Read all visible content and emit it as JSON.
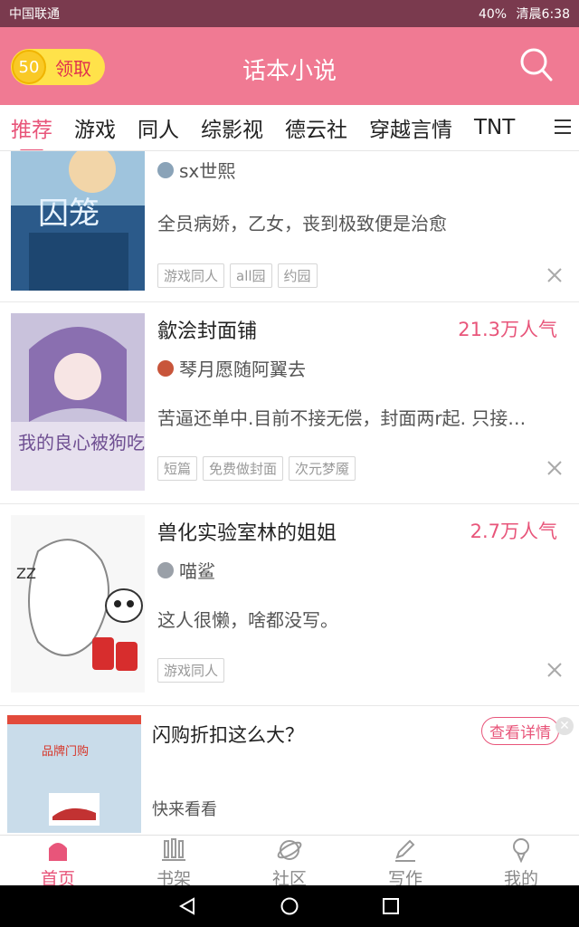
{
  "status": {
    "carrier": "中国联通",
    "battery": "40%",
    "time": "清晨6:38"
  },
  "header": {
    "coin_count": "50",
    "coin_label": "领取",
    "title": "话本小说"
  },
  "tabs": [
    "推荐",
    "游戏",
    "同人",
    "综影视",
    "德云社",
    "穿越言情",
    "TNT"
  ],
  "items": [
    {
      "title": "",
      "popularity": "",
      "author": "sx世熙",
      "desc": "全员病娇，乙女，丧到极致便是治愈",
      "tags": [
        "游戏同人",
        "all园",
        "约园"
      ],
      "cover_text": "囚笼"
    },
    {
      "title": "歙浍封面铺",
      "popularity": "21.3万人气",
      "author": "琴月愿随阿翼去",
      "desc": "苦逼还单中.目前不接无偿，封面两r起. 只接…",
      "tags": [
        "短篇",
        "免费做封面",
        "次元梦魇"
      ],
      "cover_text": "我的良心被狗吃了"
    },
    {
      "title": "兽化实验室林的姐姐",
      "popularity": "2.7万人气",
      "author": "喵鲨",
      "desc": "这人很懒，啥都没写。",
      "tags": [
        "游戏同人"
      ],
      "cover_text": ""
    }
  ],
  "ad": {
    "title": "闪购折扣这么大？",
    "subtitle": "快来看看",
    "button": "查看详情",
    "image_text": "品牌门购"
  },
  "bottom_nav": [
    {
      "label": "首页",
      "icon": "home-icon"
    },
    {
      "label": "书架",
      "icon": "bookshelf-icon"
    },
    {
      "label": "社区",
      "icon": "planet-icon"
    },
    {
      "label": "写作",
      "icon": "pen-icon"
    },
    {
      "label": "我的",
      "icon": "profile-icon"
    }
  ],
  "colors": {
    "header": "#f07a93",
    "accent": "#e8557a",
    "coin": "#ffe24a"
  }
}
